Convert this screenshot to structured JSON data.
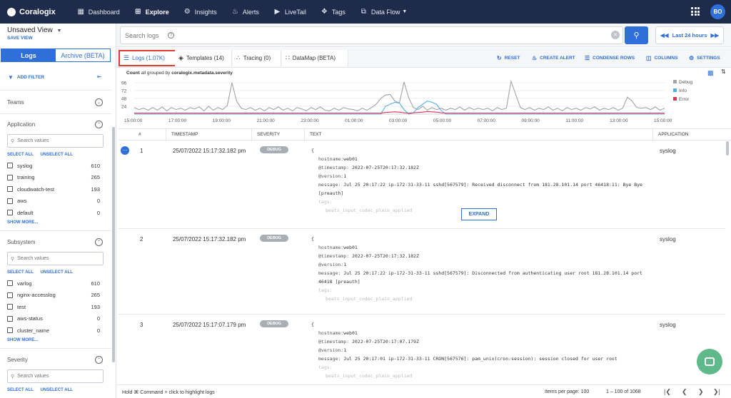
{
  "nav": {
    "brand": "Coralogix",
    "items": [
      {
        "label": "Dashboard",
        "icon": "dashboard-icon",
        "glyph": "▦"
      },
      {
        "label": "Explore",
        "icon": "explore-icon",
        "glyph": "⊞"
      },
      {
        "label": "Insights",
        "icon": "insights-icon",
        "glyph": "⚙"
      },
      {
        "label": "Alerts",
        "icon": "bell-icon",
        "glyph": "🔔"
      },
      {
        "label": "LiveTail",
        "icon": "play-icon",
        "glyph": "▶"
      },
      {
        "label": "Tags",
        "icon": "tag-icon",
        "glyph": "🏷"
      },
      {
        "label": "Data Flow",
        "icon": "data-flow-icon",
        "glyph": "⧉"
      }
    ],
    "avatar": "BO"
  },
  "sidebar": {
    "view_title": "Unsaved View",
    "save_view": "SAVE VIEW",
    "tabs": [
      "Logs",
      "Archive (BETA)"
    ],
    "add_filter": "ADD FILTER",
    "teams": "Teams",
    "select_all": "SELECT ALL",
    "unselect_all": "UNSELECT ALL",
    "show_more": "SHOW MORE...",
    "search_placeholder": "Search values",
    "application": {
      "title": "Application",
      "values": [
        {
          "label": "syslog",
          "count": "610"
        },
        {
          "label": "training",
          "count": "265"
        },
        {
          "label": "cloudwatch-test",
          "count": "193"
        },
        {
          "label": "aws",
          "count": "0"
        },
        {
          "label": "default",
          "count": "0"
        }
      ]
    },
    "subsystem": {
      "title": "Subsystem",
      "values": [
        {
          "label": "varlog",
          "count": "610"
        },
        {
          "label": "nginx-accesslog",
          "count": "265"
        },
        {
          "label": "test",
          "count": "193"
        },
        {
          "label": "aws-status",
          "count": "0"
        },
        {
          "label": "cluster_name",
          "count": "0"
        }
      ]
    },
    "severity": {
      "title": "Severity"
    }
  },
  "search": {
    "placeholder": "Search logs",
    "time_range": "Last 24 hours"
  },
  "content_tabs": [
    {
      "label": "Logs (1.07K)",
      "icon": "logs-icon"
    },
    {
      "label": "Templates (14)",
      "icon": "templates-icon"
    },
    {
      "label": "Tracing (0)",
      "icon": "tracing-icon"
    },
    {
      "label": "DataMap (BETA)",
      "icon": "datamap-icon"
    }
  ],
  "toolbar": {
    "reset": "RESET",
    "create_alert": "CREATE ALERT",
    "condense_rows": "CONDENSE ROWS",
    "columns": "COLUMNS",
    "settings": "SETTINGS"
  },
  "count_label": {
    "prefix": "Count",
    "middle": "all grouped by",
    "field": "coralogix.metadata.severity"
  },
  "chart_data": {
    "type": "line",
    "y_ticks": [
      "96",
      "72",
      "48",
      "24"
    ],
    "ylim": [
      0,
      100
    ],
    "x_ticks": [
      "15:00:00",
      "17:00:00",
      "19:00:00",
      "21:00:00",
      "23:00:00",
      "01:00:00",
      "03:00:00",
      "05:00:00",
      "07:00:00",
      "09:00:00",
      "11:00:00",
      "13:00:00",
      "15:00:00"
    ],
    "legend": "right",
    "series": [
      {
        "name": "Debug",
        "color": "#a3a3a3",
        "values": [
          20,
          14,
          18,
          12,
          20,
          12,
          22,
          10,
          20,
          14,
          18,
          12,
          20,
          16,
          22,
          10,
          24,
          12,
          20,
          14,
          26,
          96,
          40,
          18,
          14,
          20,
          12,
          18,
          10,
          20,
          14,
          22,
          12,
          18,
          10,
          20,
          16,
          10,
          20,
          14,
          22,
          12,
          10,
          18,
          12,
          20,
          16,
          14,
          10,
          18,
          12,
          20,
          30,
          48,
          58,
          60,
          40,
          34,
          98,
          50,
          20,
          14,
          24,
          12,
          20,
          14,
          18,
          12,
          18,
          14,
          22,
          12,
          20,
          14,
          18,
          14,
          18,
          10,
          20,
          14,
          18,
          100,
          60,
          20,
          14,
          20,
          12,
          18,
          14,
          22,
          12,
          18,
          10,
          20,
          14,
          18,
          12,
          20,
          16,
          22,
          12,
          18,
          14,
          20,
          12,
          18,
          52,
          40,
          20,
          18,
          20,
          14,
          22,
          12,
          18
        ]
      },
      {
        "name": "Info",
        "color": "#4fb0e0",
        "values": [
          0,
          0,
          0,
          0,
          0,
          0,
          0,
          0,
          0,
          0,
          0,
          0,
          0,
          0,
          0,
          0,
          0,
          0,
          0,
          0,
          0,
          0,
          0,
          0,
          0,
          0,
          0,
          0,
          0,
          0,
          0,
          0,
          0,
          0,
          0,
          0,
          0,
          0,
          0,
          0,
          0,
          0,
          0,
          0,
          0,
          0,
          0,
          0,
          0,
          0,
          0,
          0,
          0,
          0,
          24,
          30,
          36,
          34,
          14,
          0,
          4,
          20,
          30,
          40,
          36,
          30,
          10,
          0,
          0,
          0,
          0,
          0,
          0,
          0,
          0,
          0,
          0,
          0,
          0,
          0,
          0,
          0,
          0,
          0,
          0,
          0,
          0,
          0,
          0,
          0,
          0,
          0,
          0,
          0,
          0,
          0,
          0,
          0,
          0,
          0,
          0,
          0,
          0,
          0,
          0,
          0,
          0,
          0,
          0,
          0,
          0,
          0,
          0,
          0,
          0
        ]
      },
      {
        "name": "Error",
        "color": "#e0325a",
        "values": [
          3,
          3,
          3,
          3,
          3,
          3,
          3,
          3,
          3,
          3,
          3,
          3,
          3,
          3,
          3,
          3,
          3,
          3,
          3,
          3,
          3,
          3,
          3,
          3,
          3,
          3,
          3,
          3,
          3,
          3,
          3,
          3,
          3,
          3,
          3,
          3,
          3,
          3,
          3,
          3,
          3,
          3,
          3,
          3,
          3,
          3,
          3,
          3,
          3,
          3,
          3,
          3,
          3,
          3,
          5,
          6,
          7,
          6,
          4,
          3,
          4,
          5,
          6,
          8,
          7,
          6,
          4,
          3,
          3,
          3,
          3,
          3,
          3,
          3,
          3,
          3,
          3,
          3,
          3,
          3,
          3,
          3,
          3,
          3,
          3,
          3,
          3,
          3,
          3,
          3,
          3,
          3,
          3,
          3,
          3,
          3,
          3,
          3,
          3,
          3,
          3,
          3,
          3,
          3,
          3,
          3,
          3,
          3,
          3,
          3,
          3,
          3,
          3,
          3,
          3
        ]
      }
    ]
  },
  "table": {
    "headers": [
      "#",
      "TIMESTAMP",
      "SEVERITY",
      "TEXT",
      "APPLICATION"
    ],
    "expand_label": "EXPAND",
    "rows": [
      {
        "num": "1",
        "timestamp": "25/07/2022 15:17:32.182 pm",
        "severity": "DEBUG",
        "application": "syslog",
        "hostname": "web01",
        "ts_field": "2022-07-25T20:17:32.182Z",
        "version": "1",
        "message": "Jul 25 20:17:22 ip-172-31-33-11 sshd[567579]: Received disconnect from 181.28.101.14 port 46418:11: Bye Bye [preauth]",
        "tag": "beats_input_codec_plain_applied"
      },
      {
        "num": "2",
        "timestamp": "25/07/2022 15:17:32.182 pm",
        "severity": "DEBUG",
        "application": "syslog",
        "hostname": "web01",
        "ts_field": "2022-07-25T20:17:32.182Z",
        "version": "1",
        "message": "Jul 25 20:17:22 ip-172-31-33-11 sshd[567579]: Disconnected from authenticating user root 181.28.101.14 port 46418 [preauth]",
        "tag": "beats_input_codec_plain_applied"
      },
      {
        "num": "3",
        "timestamp": "25/07/2022 15:17:07.179 pm",
        "severity": "DEBUG",
        "application": "syslog",
        "hostname": "web01",
        "ts_field": "2022-07-25T20:17:07.179Z",
        "version": "1",
        "message": "Jul 25 20:17:01 ip-172-31-33-11 CRON[567576]: pam_unix(cron:session): session closed for user root",
        "tag": "beats_input_codec_plain_applied"
      }
    ],
    "keys": {
      "hostname": "hostname:",
      "timestamp": "@timestamp:",
      "version": "@version:",
      "message": "message:",
      "tags": "tags:",
      "open": "{"
    }
  },
  "footer": {
    "hint": "Hold ⌘ Command + click to highlight logs",
    "items_per_page": "Items per page: 100",
    "range": "1 – 100 of 1068"
  }
}
